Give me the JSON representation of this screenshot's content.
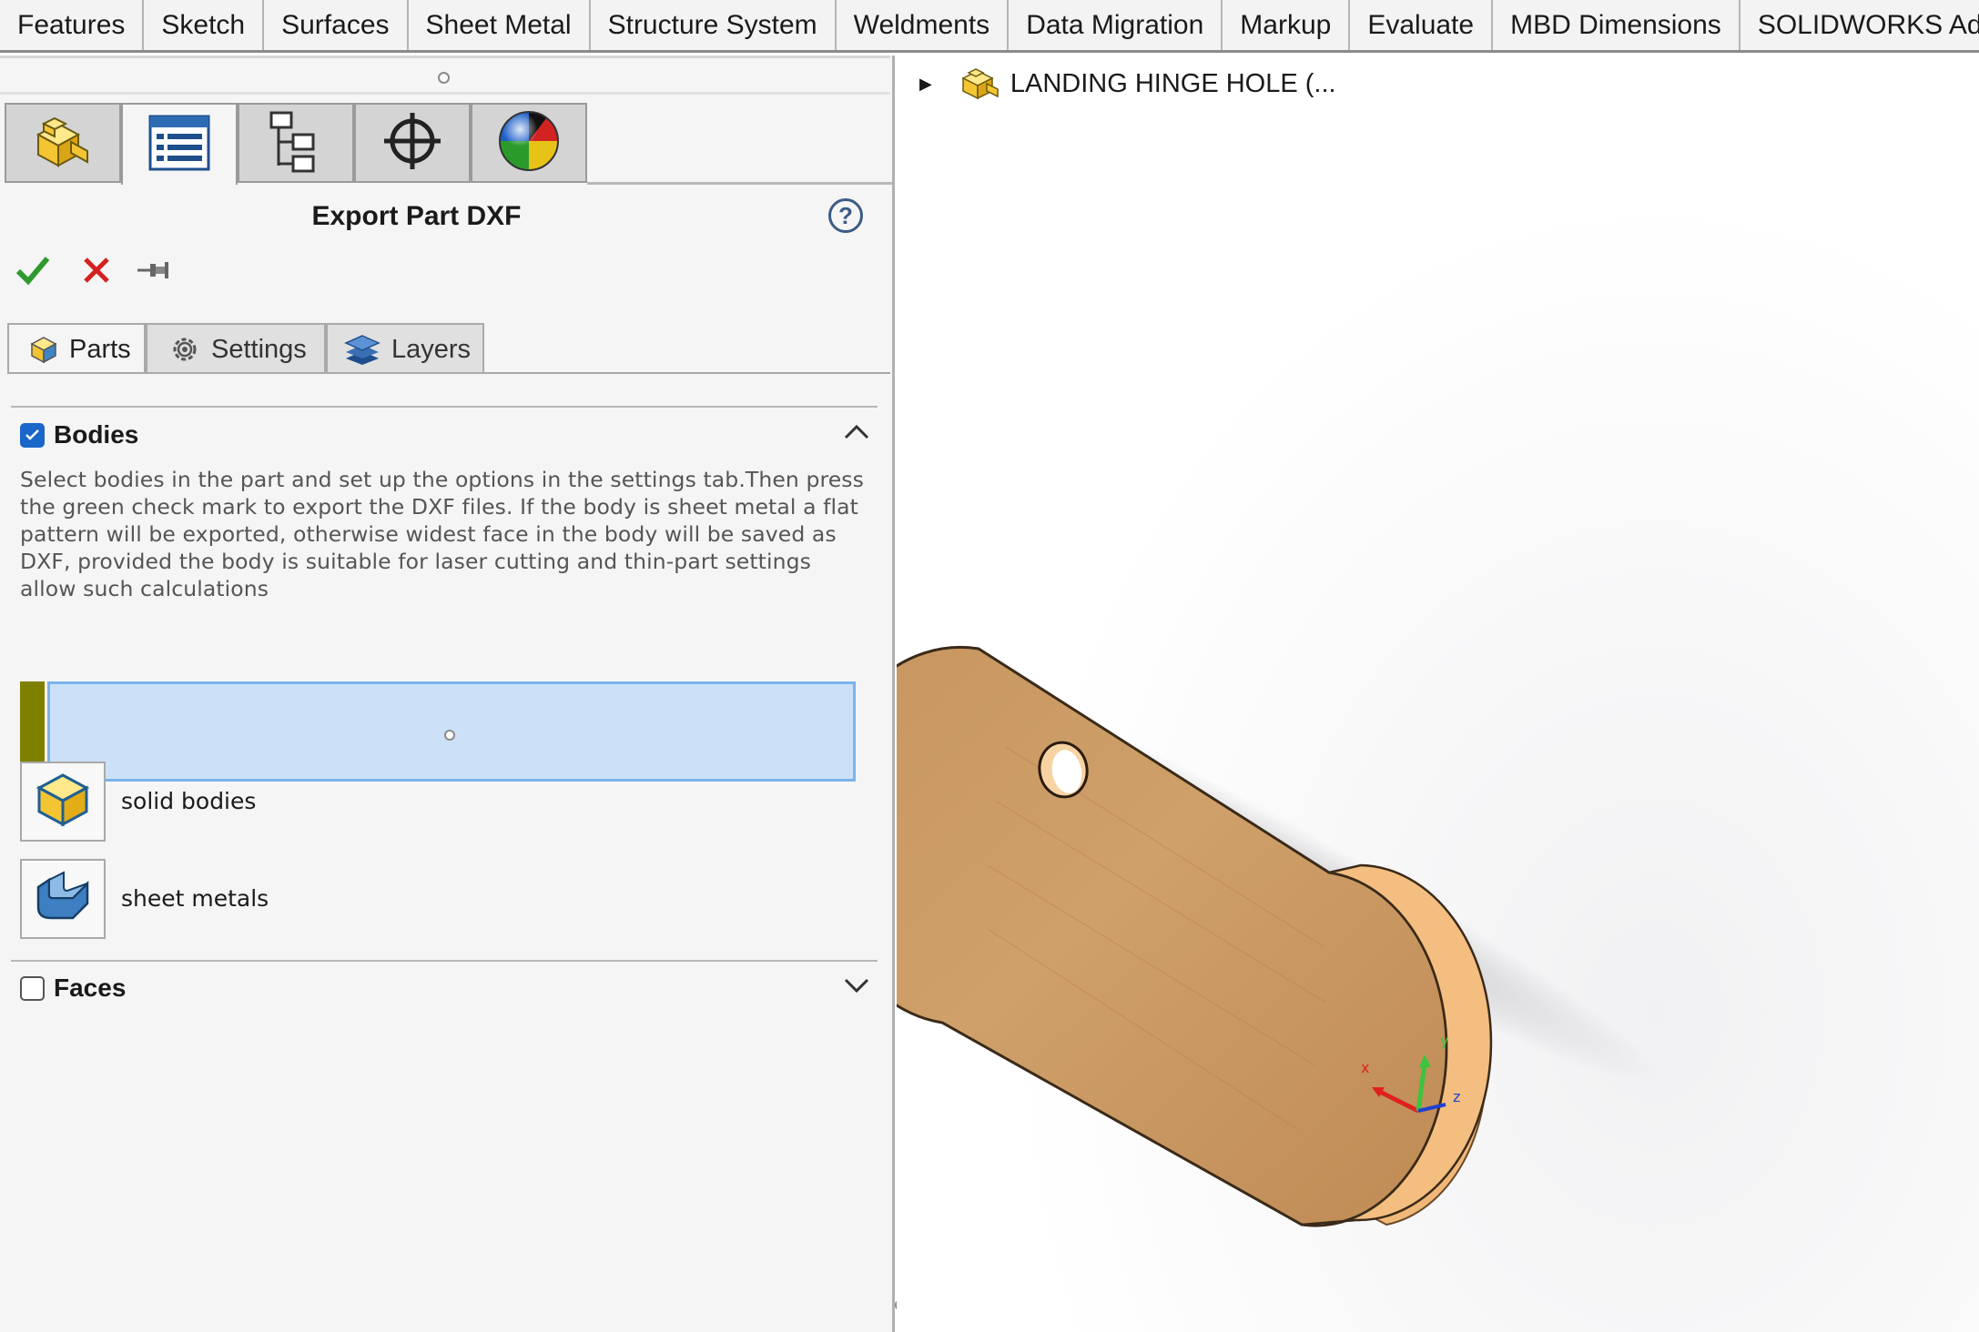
{
  "command_tabs": [
    "Features",
    "Sketch",
    "Surfaces",
    "Sheet Metal",
    "Structure System",
    "Weldments",
    "Data Migration",
    "Markup",
    "Evaluate",
    "MBD Dimensions",
    "SOLIDWORKS Add-Ins"
  ],
  "manager_tabs": [
    {
      "name": "featuremanager-tab-icon"
    },
    {
      "name": "propertymanager-tab-icon"
    },
    {
      "name": "configurationmanager-tab-icon"
    },
    {
      "name": "dimxpertmanager-tab-icon"
    },
    {
      "name": "displaymanager-tab-icon"
    }
  ],
  "property_manager": {
    "title": "Export Part DXF",
    "help_glyph": "?",
    "subtabs": {
      "parts": "Parts",
      "settings": "Settings",
      "layers": "Layers"
    },
    "bodies": {
      "label": "Bodies",
      "checked": true,
      "description": "Select bodies in the part and set up the options in the settings tab.Then press the green check mark to export the DXF files. If the body is sheet metal a flat pattern will be exported, otherwise widest face in the body will be saved as DXF, provided the body is suitable for laser cutting and thin-part settings allow such calculations",
      "selection_color": "#808000",
      "options": {
        "solid": "solid bodies",
        "sheet": "sheet metals"
      }
    },
    "faces": {
      "label": "Faces",
      "checked": false
    }
  },
  "feature_tree": {
    "root_label": "LANDING HINGE HOLE  (..."
  },
  "colors": {
    "ok_green": "#2e9a2e",
    "cancel_red": "#d42020",
    "selection_blue": "#cce1f7",
    "wood": "#c8975e"
  }
}
